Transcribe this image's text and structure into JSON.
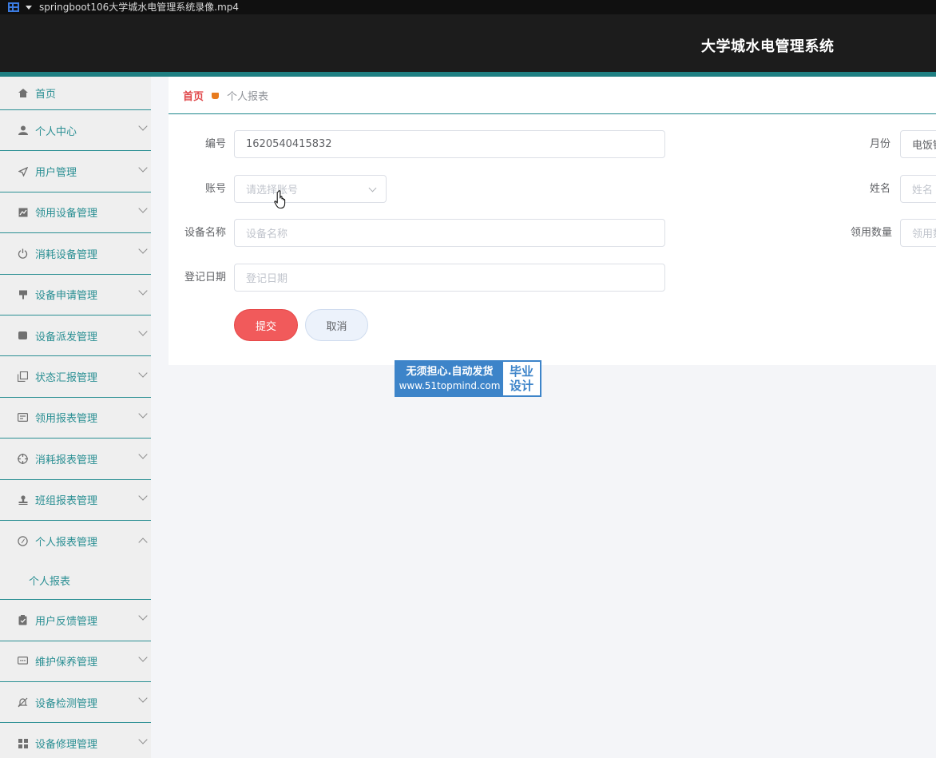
{
  "player": {
    "filename": "springboot106大学城水电管理系统录像.mp4"
  },
  "header": {
    "title": "大学城水电管理系统"
  },
  "sidebar": {
    "home": {
      "label": "首页",
      "icon": "home-icon"
    },
    "items": [
      {
        "label": "个人中心",
        "icon": "user-icon"
      },
      {
        "label": "用户管理",
        "icon": "send-icon"
      },
      {
        "label": "领用设备管理",
        "icon": "chart-icon"
      },
      {
        "label": "消耗设备管理",
        "icon": "power-icon"
      },
      {
        "label": "设备申请管理",
        "icon": "brush-icon"
      },
      {
        "label": "设备派发管理",
        "icon": "printer-icon"
      },
      {
        "label": "状态汇报管理",
        "icon": "copy-icon"
      },
      {
        "label": "领用报表管理",
        "icon": "card-icon"
      },
      {
        "label": "消耗报表管理",
        "icon": "aim-icon"
      },
      {
        "label": "班组报表管理",
        "icon": "stamp-icon"
      },
      {
        "label": "个人报表管理",
        "icon": "compass-icon"
      }
    ],
    "submenu": {
      "label": "个人报表"
    },
    "items_after": [
      {
        "label": "用户反馈管理",
        "icon": "clipboard-icon"
      },
      {
        "label": "维护保养管理",
        "icon": "chat-icon"
      },
      {
        "label": "设备检测管理",
        "icon": "bell-off-icon"
      },
      {
        "label": "设备修理管理",
        "icon": "grid-icon"
      }
    ]
  },
  "breadcrumb": {
    "home": "首页",
    "current": "个人报表"
  },
  "form": {
    "bianhao": {
      "label": "编号",
      "value": "1620540415832"
    },
    "yuefen": {
      "label": "月份",
      "value": "电饭锅"
    },
    "zhanghao": {
      "label": "账号",
      "placeholder": "请选择账号"
    },
    "xingming": {
      "label": "姓名",
      "placeholder": "姓名"
    },
    "shebeimingcheng": {
      "label": "设备名称",
      "placeholder": "设备名称"
    },
    "lingyongshuliang": {
      "label": "领用数量",
      "placeholder": "领用数量"
    },
    "dengjiriqi": {
      "label": "登记日期",
      "placeholder": "登记日期"
    },
    "submit": "提交",
    "cancel": "取消"
  },
  "watermark": {
    "line1": "无须担心.自动发货",
    "line2": "www.51topmind.com",
    "badge1": "毕业",
    "badge2": "设计"
  },
  "colors": {
    "accent": "#2a8f93",
    "header_bg": "#1c1c1c",
    "submit": "#f15a5b",
    "breadcrumb_home": "#e0474a"
  }
}
